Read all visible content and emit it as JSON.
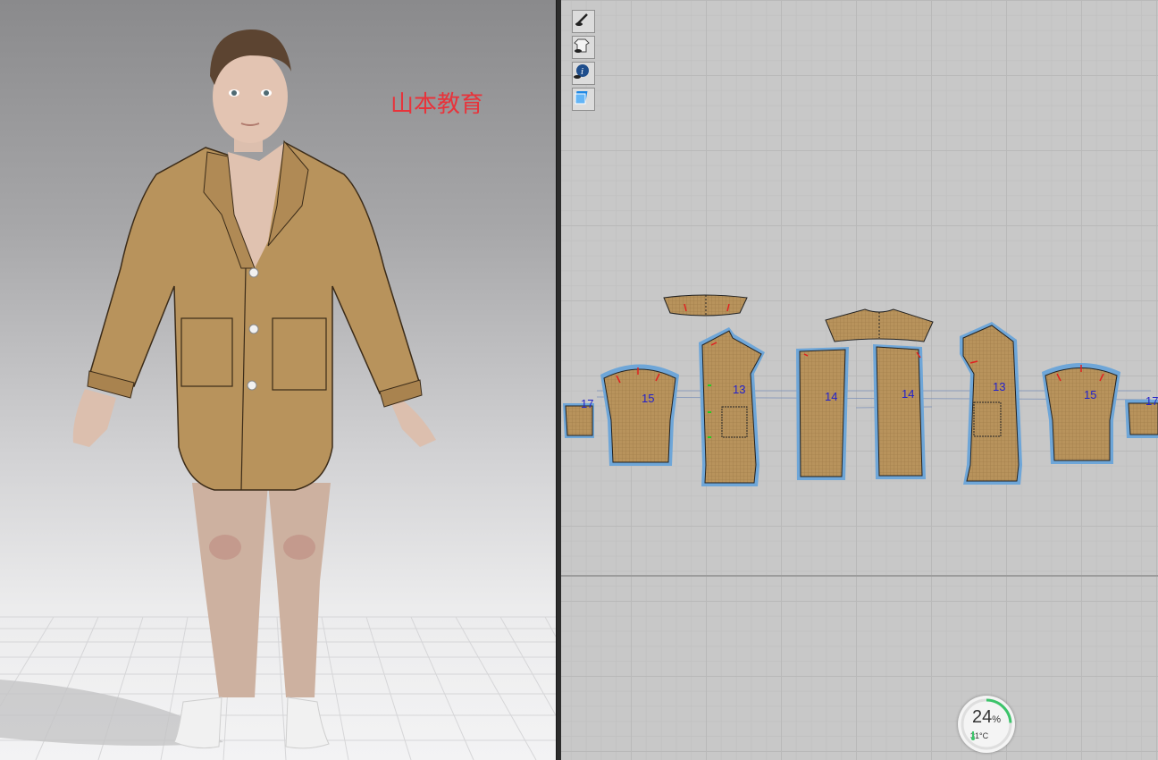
{
  "viewport_3d": {
    "watermark": "山本教育"
  },
  "toolbar_2d": {
    "tools": [
      {
        "icon": "show-pattern-icon"
      },
      {
        "icon": "show-garment-icon"
      },
      {
        "icon": "show-info-icon"
      },
      {
        "icon": "show-texture-icon"
      }
    ]
  },
  "pattern_pieces": [
    {
      "id": "collar",
      "label": ""
    },
    {
      "id": "back-yoke",
      "label": ""
    },
    {
      "id": "cuff-left",
      "label": "17"
    },
    {
      "id": "sleeve-left",
      "label": "15"
    },
    {
      "id": "front-left",
      "label": "13"
    },
    {
      "id": "back-left",
      "label": "14"
    },
    {
      "id": "back-right",
      "label": "14"
    },
    {
      "id": "front-right",
      "label": "13"
    },
    {
      "id": "sleeve-right",
      "label": "15"
    },
    {
      "id": "cuff-right",
      "label": "17"
    }
  ],
  "status": {
    "cpu_percent": "24",
    "cpu_unit": "%",
    "temperature": "31°C",
    "cpu_fraction": 0.24
  },
  "colors": {
    "fabric": "#b8935c",
    "outline_blue": "#6ea6d8",
    "label_blue": "#2222cc",
    "watermark_red": "#e8333b",
    "gauge_green": "#3cc46a"
  }
}
